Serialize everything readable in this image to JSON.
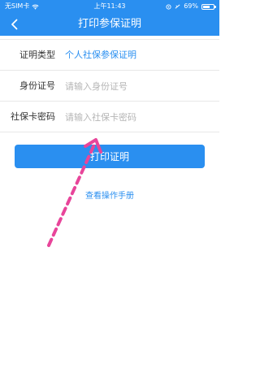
{
  "status_bar": {
    "carrier": "无SIM卡",
    "time": "上午11:43",
    "battery_text": "69%",
    "battery_level": 0.69
  },
  "nav": {
    "title": "打印参保证明",
    "back_icon": "chevron-left-icon"
  },
  "form": {
    "rows": [
      {
        "label": "证明类型",
        "value": "个人社保参保证明"
      },
      {
        "label": "身份证号",
        "placeholder": "请输入身份证号",
        "value": ""
      },
      {
        "label": "社保卡密码",
        "placeholder": "请输入社保卡密码",
        "value": ""
      }
    ]
  },
  "actions": {
    "print_label": "打印证明",
    "manual_link": "查看操作手册"
  },
  "colors": {
    "accent": "#2a8ff0",
    "annotation_arrow": "#e8459a"
  }
}
